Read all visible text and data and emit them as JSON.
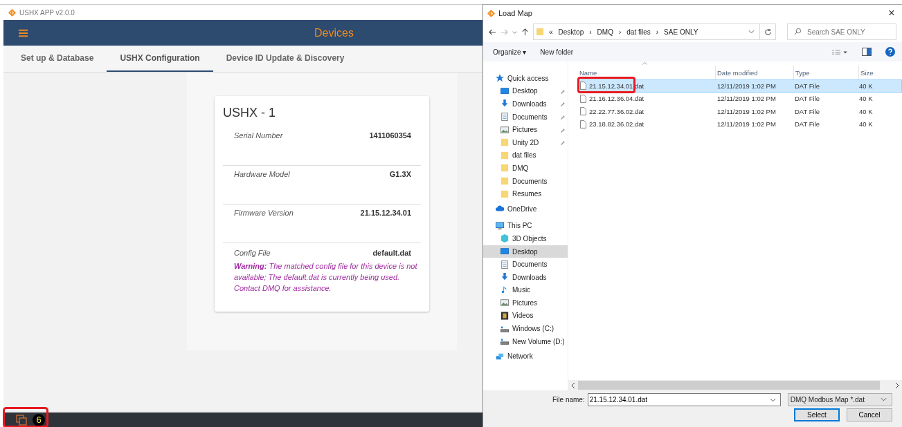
{
  "app": {
    "window_title": "USHX APP v2.0.0",
    "header_title": "Devices",
    "tabs": [
      {
        "label": "Set up & Database",
        "selected": false
      },
      {
        "label": "USHX Configuration",
        "selected": true
      },
      {
        "label": "Device ID Update & Discovery",
        "selected": false
      }
    ],
    "device_card": {
      "title": "USHX - 1",
      "fields": [
        {
          "label": "Serial Number",
          "value": "1411060354"
        },
        {
          "label": "Hardware Model",
          "value": "G1.3X"
        },
        {
          "label": "Firmware Version",
          "value": "21.15.12.34.01"
        },
        {
          "label": "Config File",
          "value": "default.dat",
          "warning": "**Warning:** The matched config file for this device is not available; The default.dat is currently being used. Contact DMQ for assistance."
        }
      ]
    },
    "taskbar": {
      "badge": "6",
      "highlighted": true
    }
  },
  "dialog": {
    "title": "Load Map",
    "close": "×",
    "breadcrumb": [
      "«",
      "Desktop",
      "›",
      "DMQ",
      "›",
      "dat files",
      "›",
      "SAE ONLY"
    ],
    "search": {
      "placeholder": "Search SAE ONLY"
    },
    "toolbar": {
      "organize": "Organize ▾",
      "new_folder": "New folder"
    },
    "nav": [
      {
        "label": "Quick access",
        "kind": "star",
        "children": [
          {
            "label": "Desktop",
            "kind": "desktop",
            "pinned": true,
            "selected": false
          },
          {
            "label": "Downloads",
            "kind": "download",
            "pinned": true,
            "selected": false
          },
          {
            "label": "Documents",
            "kind": "document",
            "pinned": true,
            "selected": false
          },
          {
            "label": "Pictures",
            "kind": "pictures",
            "pinned": true,
            "selected": false
          },
          {
            "label": "Unity 2D",
            "kind": "folder",
            "pinned": true,
            "selected": false
          },
          {
            "label": "dat files",
            "kind": "folder",
            "pinned": false,
            "selected": false
          },
          {
            "label": "DMQ",
            "kind": "folder",
            "pinned": false,
            "selected": false
          },
          {
            "label": "Documents",
            "kind": "folder",
            "pinned": false,
            "selected": false
          },
          {
            "label": "Resumes",
            "kind": "folder",
            "pinned": false,
            "selected": false
          }
        ]
      },
      {
        "label": "OneDrive",
        "kind": "cloud"
      },
      {
        "label": "This PC",
        "kind": "pc",
        "children": [
          {
            "label": "3D Objects",
            "kind": "cube",
            "pinned": false,
            "selected": false
          },
          {
            "label": "Desktop",
            "kind": "desktop",
            "pinned": false,
            "selected": true
          },
          {
            "label": "Documents",
            "kind": "document",
            "pinned": false,
            "selected": false
          },
          {
            "label": "Downloads",
            "kind": "download",
            "pinned": false,
            "selected": false
          },
          {
            "label": "Music",
            "kind": "music",
            "pinned": false,
            "selected": false
          },
          {
            "label": "Pictures",
            "kind": "pictures",
            "pinned": false,
            "selected": false
          },
          {
            "label": "Videos",
            "kind": "video",
            "pinned": false,
            "selected": false
          },
          {
            "label": "Windows (C:)",
            "kind": "drive",
            "pinned": false,
            "selected": false
          },
          {
            "label": "New Volume (D:)",
            "kind": "drive",
            "pinned": false,
            "selected": false
          }
        ]
      },
      {
        "label": "Network",
        "kind": "network"
      }
    ],
    "columns": [
      "Name",
      "Date modified",
      "Type",
      "Size"
    ],
    "files": [
      {
        "name": "21.15.12.34.01.dat",
        "date": "12/11/2019 1:02 PM",
        "type": "DAT File",
        "size": "40 K",
        "selected": true,
        "highlighted": true
      },
      {
        "name": "21.16.12.36.04.dat",
        "date": "12/11/2019 1:02 PM",
        "type": "DAT File",
        "size": "40 K",
        "selected": false,
        "highlighted": false
      },
      {
        "name": "22.22.77.36.02.dat",
        "date": "12/11/2019 1:02 PM",
        "type": "DAT File",
        "size": "40 K",
        "selected": false,
        "highlighted": false
      },
      {
        "name": "23.18.82.36.02.dat",
        "date": "12/11/2019 1:02 PM",
        "type": "DAT File",
        "size": "40 K",
        "selected": false,
        "highlighted": false
      }
    ],
    "file_name_label": "File name:",
    "file_name": "21.15.12.34.01.dat",
    "file_type": "DMQ Modbus Map *.dat",
    "buttons": [
      "Select",
      "Cancel"
    ]
  }
}
